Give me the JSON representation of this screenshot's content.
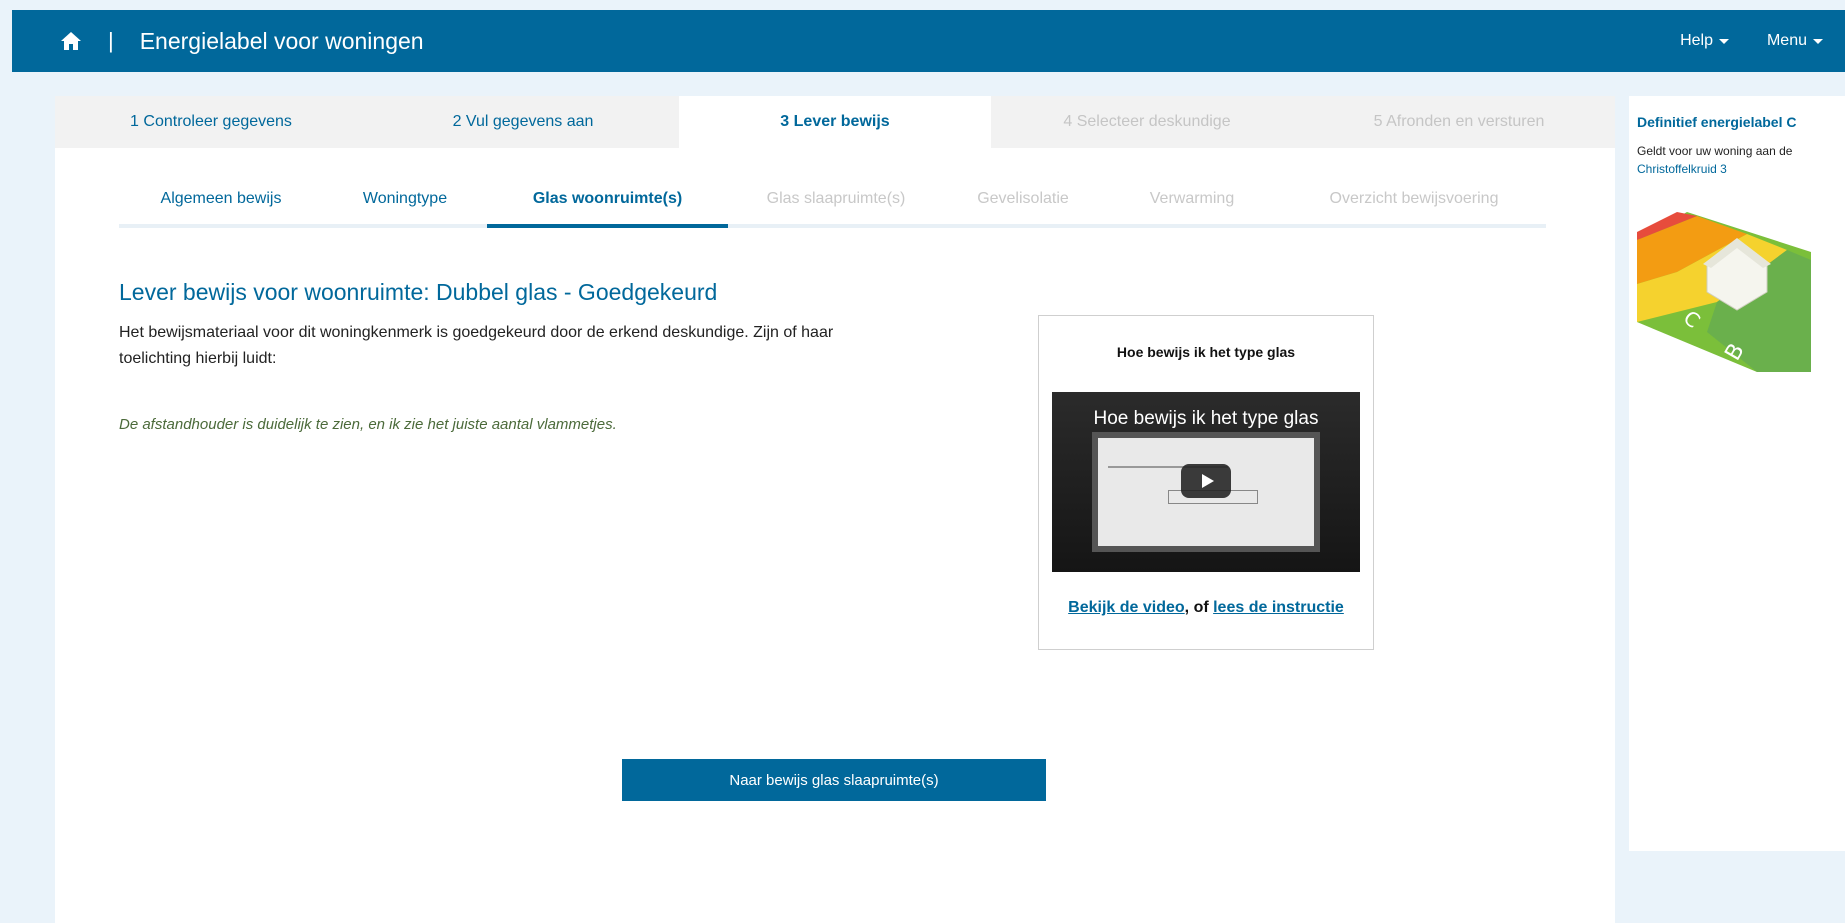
{
  "header": {
    "title": "Energielabel voor woningen",
    "separator": "|",
    "help_label": "Help",
    "menu_label": "Menu",
    "brand_color": "#01689b"
  },
  "steps": [
    {
      "label": "1 Controleer gegevens",
      "state": "done"
    },
    {
      "label": "2 Vul gegevens aan",
      "state": "done"
    },
    {
      "label": "3 Lever bewijs",
      "state": "active"
    },
    {
      "label": "4 Selecteer deskundige",
      "state": "disabled"
    },
    {
      "label": "5 Afronden en versturen",
      "state": "disabled"
    }
  ],
  "subtabs": [
    {
      "label": "Algemeen bewijs",
      "state": "done"
    },
    {
      "label": "Woningtype",
      "state": "done"
    },
    {
      "label": "Glas woonruimte(s)",
      "state": "active"
    },
    {
      "label": "Glas slaapruimte(s)",
      "state": "disabled"
    },
    {
      "label": "Gevelisolatie",
      "state": "disabled"
    },
    {
      "label": "Verwarming",
      "state": "disabled"
    },
    {
      "label": "Overzicht bewijsvoering",
      "state": "disabled"
    }
  ],
  "content": {
    "heading": "Lever bewijs voor woonruimte: Dubbel glas - Goedgekeurd",
    "paragraph": "Het bewijsmateriaal voor dit woningkenmerk is goedgekeurd door de erkend deskundige. Zijn of haar toelichting hierbij luidt:",
    "quote": "De afstandhouder is duidelijk te zien, en ik zie het juiste aantal vlammetjes."
  },
  "video": {
    "card_title": "Hoe bewijs ik het type glas",
    "thumb_title": "Hoe bewijs ik het type glas",
    "link_video": "Bekijk de video",
    "link_separator": ", of ",
    "link_instruction": "lees de instructie"
  },
  "next_button": "Naar bewijs glas slaapruimte(s)",
  "side": {
    "title": "Definitief energielabel C",
    "text": "Geldt voor uw woning aan de",
    "address": "Christoffelkruid 3",
    "label_graphic_icon": "energy-label-house-icon"
  }
}
